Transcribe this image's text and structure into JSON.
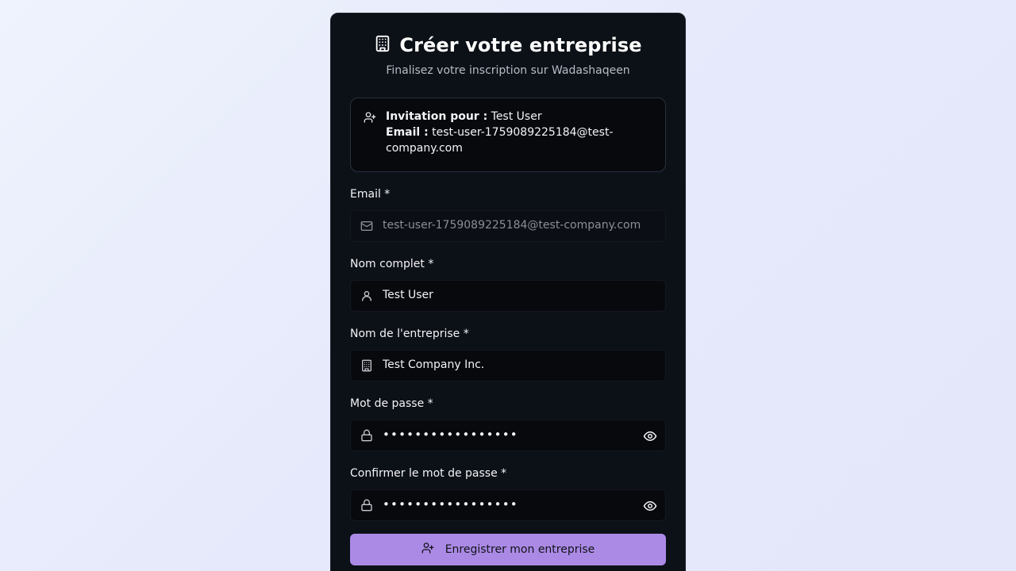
{
  "header": {
    "title": "Créer votre entreprise",
    "subtitle": "Finalisez votre inscription sur Wadashaqeen",
    "icon": "building-icon"
  },
  "invitation": {
    "icon": "user-plus-icon",
    "for_label": "Invitation pour :",
    "for_value": "Test User",
    "email_label": "Email :",
    "email_value": "test-user-1759089225184@test-company.com"
  },
  "form": {
    "email": {
      "label": "Email *",
      "value": "test-user-1759089225184@test-company.com",
      "icon": "mail-icon",
      "disabled": true
    },
    "full_name": {
      "label": "Nom complet *",
      "value": "Test User",
      "icon": "user-icon"
    },
    "company": {
      "label": "Nom de l'entreprise *",
      "value": "Test Company Inc.",
      "icon": "building-icon"
    },
    "password": {
      "label": "Mot de passe *",
      "value": "•••••••••••••••••",
      "icon": "lock-icon",
      "toggle_icon": "eye-icon"
    },
    "confirm_password": {
      "label": "Confirmer le mot de passe *",
      "value": "•••••••••••••••••",
      "icon": "lock-icon",
      "toggle_icon": "eye-icon"
    }
  },
  "submit": {
    "label": "Enregistrer mon entreprise",
    "icon": "user-plus-icon"
  },
  "colors": {
    "card_bg": "#0c1017",
    "accent": "#ab8ae6",
    "page_bg": "#eef3fd"
  }
}
